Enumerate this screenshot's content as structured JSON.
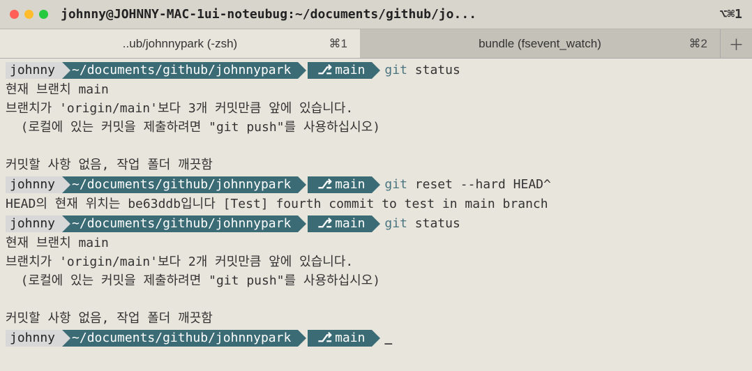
{
  "titlebar": {
    "title": "johnny@JOHNNY-MAC-1ui-noteubug:~/documents/github/jo...",
    "shortcut": "⌥⌘1"
  },
  "tabs": {
    "tab1": {
      "label": "..ub/johnnypark (-zsh)",
      "shortcut": "⌘1"
    },
    "tab2": {
      "label": "bundle (fsevent_watch)",
      "shortcut": "⌘2"
    },
    "newtab": "＋"
  },
  "prompt": {
    "user": "johnny",
    "path": "~/documents/github/johnnypark",
    "branch_icon": "⎇",
    "branch": "main"
  },
  "blocks": [
    {
      "cmd_git": "git",
      "cmd_rest": " status",
      "out": [
        "현재 브랜치 main",
        "브랜치가 'origin/main'보다 3개 커밋만큼 앞에 있습니다.",
        "  (로컬에 있는 커밋을 제출하려면 \"git push\"를 사용하십시오)",
        "",
        "커밋할 사항 없음, 작업 폴더 깨끗함"
      ]
    },
    {
      "cmd_git": "git",
      "cmd_rest": " reset --hard HEAD^",
      "out": [
        "HEAD의 현재 위치는 be63ddb입니다 [Test] fourth commit to test in main branch"
      ]
    },
    {
      "cmd_git": "git",
      "cmd_rest": " status",
      "out": [
        "현재 브랜치 main",
        "브랜치가 'origin/main'보다 2개 커밋만큼 앞에 있습니다.",
        "  (로컬에 있는 커밋을 제출하려면 \"git push\"를 사용하십시오)",
        "",
        "커밋할 사항 없음, 작업 폴더 깨끗함"
      ]
    }
  ],
  "cursor": "_"
}
